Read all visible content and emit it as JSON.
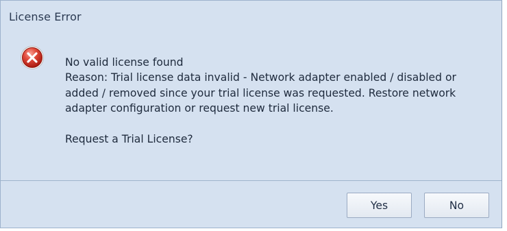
{
  "dialog": {
    "title": "License Error",
    "icon": "error-icon",
    "message": {
      "line1": "No valid license found",
      "line2": "Reason: Trial license data invalid - Network adapter enabled / disabled or",
      "line3": "added / removed since your trial license was requested. Restore network",
      "line4": "adapter configuration or request new trial license.",
      "question": "Request a Trial License?"
    },
    "buttons": {
      "yes_label": "Yes",
      "no_label": "No"
    },
    "colors": {
      "background": "#d5e1f0",
      "error_red": "#d7322b",
      "text": "#1e2a3c"
    }
  }
}
